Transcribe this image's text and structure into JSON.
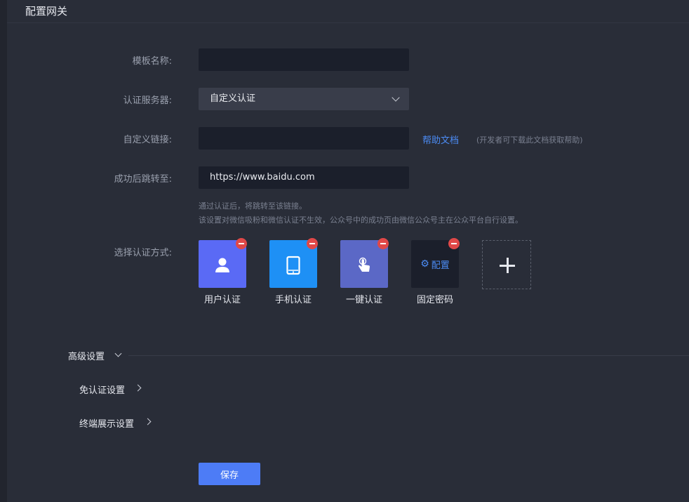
{
  "header": {
    "title": "配置网关"
  },
  "form": {
    "template_name": {
      "label": "模板名称:",
      "value": ""
    },
    "auth_server": {
      "label": "认证服务器:",
      "selected": "自定义认证"
    },
    "custom_link": {
      "label": "自定义链接:",
      "value": "",
      "help_link": "帮助文档",
      "help_note": "(开发者可下载此文档获取帮助)"
    },
    "redirect": {
      "label": "成功后跳转至:",
      "value": "https://www.baidu.com",
      "hint_line1": "通过认证后，将跳转至该链接。",
      "hint_line2": "该设置对微信吸粉和微信认证不生效，公众号中的成功页由微信公众号主在公众平台自行设置。"
    },
    "auth_methods": {
      "label": "选择认证方式:",
      "items": [
        {
          "label": "用户认证",
          "icon": "user-icon",
          "color": "#5a6af5"
        },
        {
          "label": "手机认证",
          "icon": "phone-icon",
          "color": "#1e90f5"
        },
        {
          "label": "一键认证",
          "icon": "hand-tap-icon",
          "color": "#5b68c6"
        },
        {
          "label": "固定密码",
          "icon": "gear-icon",
          "config_label": "配置",
          "color": "#1b1f2b"
        }
      ]
    }
  },
  "advanced": {
    "title": "高级设置",
    "sections": [
      "免认证设置",
      "终端展示设置"
    ]
  },
  "save_label": "保存",
  "colors": {
    "accent": "#4d7cf6",
    "link": "#4c8cf5",
    "remove": "#e04848",
    "background": "#292d38"
  }
}
